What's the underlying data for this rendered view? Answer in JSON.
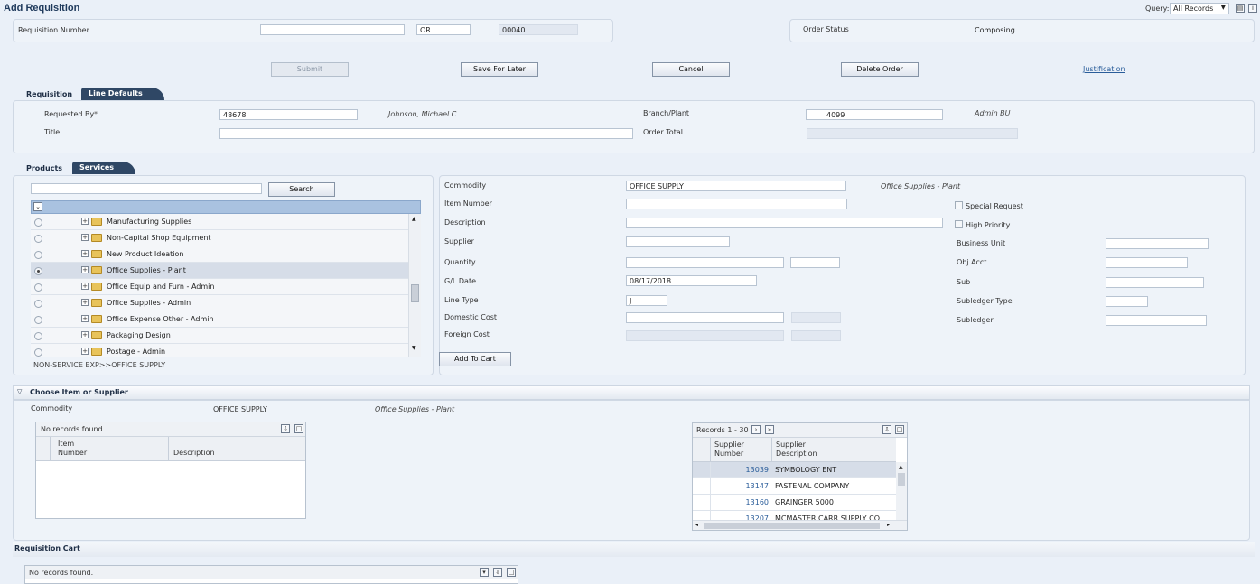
{
  "header": {
    "title": "Add Requisition",
    "query_label": "Query:",
    "query_value": "All Records",
    "icons": [
      "personalize-icon",
      "info-icon"
    ]
  },
  "req": {
    "number_label": "Requisition Number",
    "number_value": "",
    "type_value": "OR",
    "company_value": "00040",
    "status_label": "Order Status",
    "status_value": "Composing"
  },
  "actions": {
    "submit": "Submit",
    "save_later": "Save For Later",
    "cancel": "Cancel",
    "delete_order": "Delete Order",
    "justification": "Justification"
  },
  "tabs1": {
    "requisition": "Requisition",
    "line_defaults": "Line Defaults"
  },
  "header_fields": {
    "requested_by_label": "Requested By",
    "required_mark": "*",
    "requested_by_value": "48678",
    "requested_by_name": "Johnson, Michael C",
    "branch_label": "Branch/Plant",
    "branch_value": "4099",
    "branch_desc": "Admin BU",
    "title_label": "Title",
    "title_value": "",
    "order_total_label": "Order Total",
    "order_total_value": ""
  },
  "tabs2": {
    "products": "Products",
    "services": "Services"
  },
  "tree": {
    "search_value": "",
    "search_button": "Search",
    "items": [
      {
        "label": "Manufacturing Supplies",
        "selected": false
      },
      {
        "label": "Non-Capital Shop Equipment",
        "selected": false
      },
      {
        "label": "New Product Ideation",
        "selected": false
      },
      {
        "label": "Office Supplies - Plant",
        "selected": true
      },
      {
        "label": "Office Equip and Furn - Admin",
        "selected": false
      },
      {
        "label": "Office Supplies - Admin",
        "selected": false
      },
      {
        "label": "Office Expense Other - Admin",
        "selected": false
      },
      {
        "label": "Packaging Design",
        "selected": false
      },
      {
        "label": "Postage - Admin",
        "selected": false
      }
    ],
    "path": "NON-SERVICE EXP>>OFFICE SUPPLY"
  },
  "item_form": {
    "commodity_label": "Commodity",
    "commodity_value": "OFFICE SUPPLY",
    "commodity_desc": "Office Supplies - Plant",
    "item_number_label": "Item Number",
    "description_label": "Description",
    "supplier_label": "Supplier",
    "quantity_label": "Quantity",
    "gl_date_label": "G/L Date",
    "gl_date_value": "08/17/2018",
    "line_type_label": "Line Type",
    "line_type_value": "J",
    "domestic_cost_label": "Domestic Cost",
    "foreign_cost_label": "Foreign Cost",
    "add_to_cart": "Add To Cart",
    "special_request_label": "Special Request",
    "high_priority_label": "High Priority",
    "business_unit_label": "Business Unit",
    "obj_acct_label": "Obj Acct",
    "sub_label": "Sub",
    "subledger_type_label": "Subledger Type",
    "subledger_label": "Subledger"
  },
  "choose": {
    "title": "Choose Item or Supplier",
    "commodity_label": "Commodity",
    "commodity_value": "OFFICE SUPPLY",
    "commodity_desc": "Office Supplies - Plant",
    "items_grid": {
      "empty_text": "No records found.",
      "col_item_number": "Item\nNumber",
      "col_description": "Description"
    },
    "supplier_grid": {
      "records_text": "Records 1 - 30",
      "col_supplier_number": "Supplier\nNumber",
      "col_supplier_desc": "Supplier\nDescription",
      "rows": [
        {
          "number": "13039",
          "desc": "SYMBOLOGY ENT"
        },
        {
          "number": "13147",
          "desc": "FASTENAL COMPANY"
        },
        {
          "number": "13160",
          "desc": "GRAINGER 5000"
        },
        {
          "number": "13207",
          "desc": "MCMASTER CARR SUPPLY CO"
        }
      ]
    }
  },
  "cart": {
    "title": "Requisition Cart",
    "empty_text": "No records found."
  }
}
